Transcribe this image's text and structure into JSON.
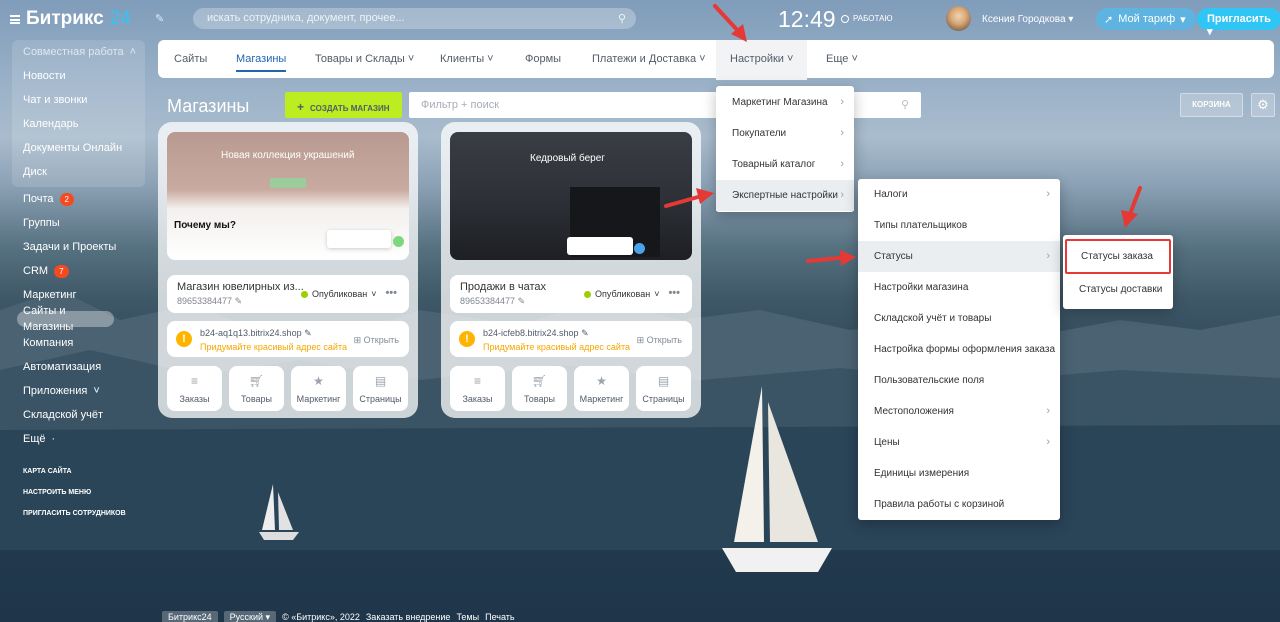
{
  "header": {
    "logo_name": "Битрикс",
    "logo_num": "24",
    "search_placeholder": "искать сотрудника, документ, прочее...",
    "clock": "12:49",
    "status": "РАБОТАЮ",
    "user_name": "Ксения Городкова",
    "tariff_label": "Мой тариф",
    "invite_label": "Пригласить"
  },
  "sidebar": {
    "section_title": "Совместная работа",
    "section_items": [
      "Новости",
      "Чат и звонки",
      "Календарь",
      "Документы Онлайн",
      "Диск"
    ],
    "mail": {
      "label": "Почта",
      "badge": "2"
    },
    "groups": "Группы",
    "tasks": "Задачи и Проекты",
    "crm": {
      "label": "CRM",
      "badge": "7"
    },
    "marketing": "Маркетинг",
    "sites": "Сайты и Магазины",
    "company": "Компания",
    "automation": "Автоматизация",
    "apps": "Приложения",
    "warehouse": "Складской учёт",
    "more": "Ещё",
    "small": [
      "КАРТА САЙТА",
      "НАСТРОИТЬ МЕНЮ",
      "ПРИГЛАСИТЬ СОТРУДНИКОВ"
    ]
  },
  "nav": {
    "tabs": [
      "Сайты",
      "Магазины",
      "Товары и Склады",
      "Клиенты",
      "Формы",
      "Платежи и Доставка",
      "Настройки",
      "Еще"
    ]
  },
  "toolbar": {
    "title": "Магазины",
    "create": "СОЗДАТЬ МАГАЗИН",
    "filter_placeholder": "Фильтр + поиск",
    "cart": "КОРЗИНА"
  },
  "cards": [
    {
      "preview_title": "Новая коллекция украшений",
      "preview_sub": "Почему мы?",
      "name": "Магазин ювелирных из...",
      "phone": "89653384477",
      "status": "Опубликован",
      "domain": "b24-aq1q13.bitrix24.shop",
      "advice": "Придумайте красивый адрес сайта",
      "open": "Открыть",
      "buttons": [
        "Заказы",
        "Товары",
        "Маркетинг",
        "Страницы"
      ]
    },
    {
      "preview_title": "Кедровый берег",
      "preview_sub": "",
      "name": "Продажи в чатах",
      "phone": "89653384477",
      "status": "Опубликован",
      "domain": "b24-icfeb8.bitrix24.shop",
      "advice": "Придумайте красивый адрес сайта",
      "open": "Открыть",
      "buttons": [
        "Заказы",
        "Товары",
        "Маркетинг",
        "Страницы"
      ]
    }
  ],
  "settings_menu": [
    "Маркетинг Магазина",
    "Покупатели",
    "Товарный каталог",
    "Экспертные настройки"
  ],
  "expert_menu": [
    "Налоги",
    "Типы плательщиков",
    "Статусы",
    "Настройки магазина",
    "Складской учёт и товары",
    "Настройка формы оформления заказа",
    "Пользовательские поля",
    "Местоположения",
    "Цены",
    "Единицы измерения",
    "Правила работы с корзиной"
  ],
  "status_menu": [
    "Статусы заказа",
    "Статусы доставки"
  ],
  "footer": {
    "logo": "Битрикс24",
    "lang": "Русский",
    "copyright": "© «Битрикс», 2022",
    "links": [
      "Заказать внедрение",
      "Темы",
      "Печать"
    ]
  }
}
